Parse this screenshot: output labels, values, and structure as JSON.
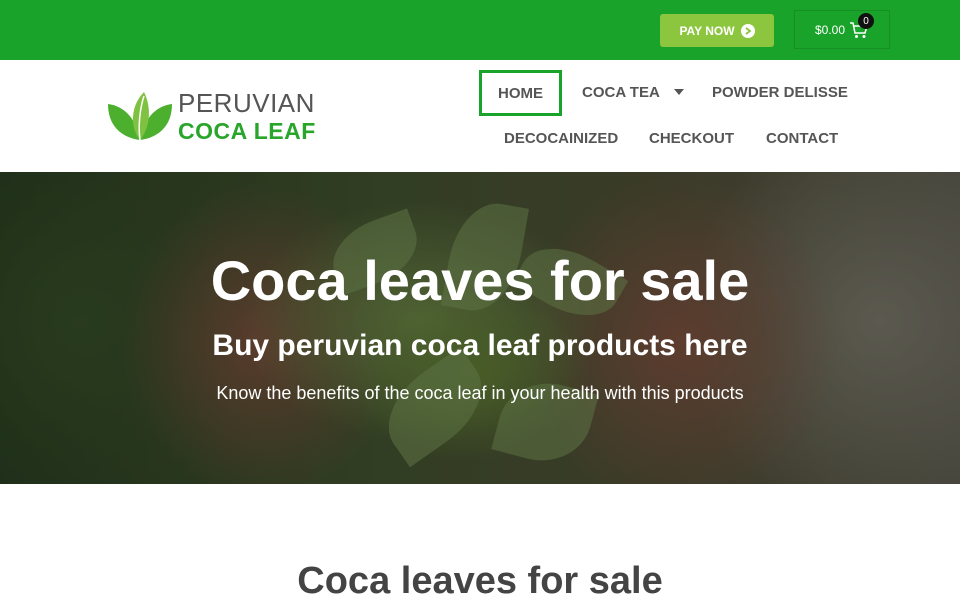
{
  "topbar": {
    "pay_label": "PAY NOW",
    "cart_amount": "$0.00",
    "cart_count": "0",
    "bg_color": "#1aa32a",
    "pay_color": "#8cc63f"
  },
  "header": {
    "logo_line1": "PERUVIAN",
    "logo_line2": "COCA LEAF",
    "nav": {
      "home": "HOME",
      "coca_tea": "COCA TEA",
      "powder": "POWDER DELISSE",
      "decaf": "DECOCAINIZED",
      "checkout": "CHECKOUT",
      "contact": "CONTACT"
    }
  },
  "hero": {
    "title": "Coca leaves for sale",
    "subtitle": "Buy peruvian coca leaf products here",
    "text": "Know the benefits of the coca leaf in your health with this products"
  },
  "section": {
    "title": "Coca leaves for sale"
  }
}
